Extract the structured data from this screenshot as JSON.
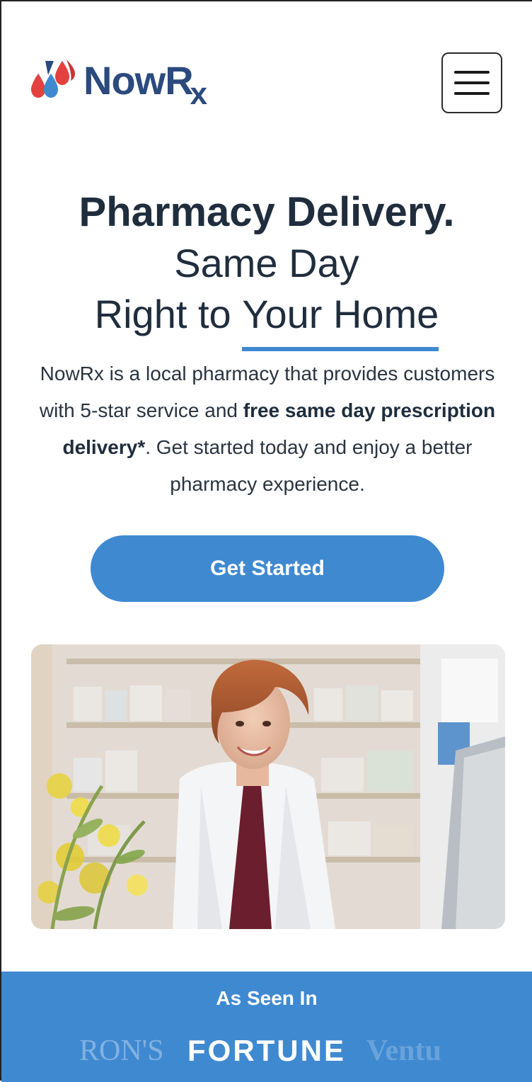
{
  "header": {
    "brand": "NowR",
    "brand_sub": "x",
    "menu_icon": "hamburger-icon"
  },
  "hero": {
    "line1": "Pharmacy Delivery.",
    "line2": "Same Day",
    "line3_prefix": "Right to ",
    "line3_underlined": "Your Home",
    "desc_pre": "NowRx is a local pharmacy that provides customers with 5-star service and ",
    "desc_bold": "free same day prescription delivery*",
    "desc_post": ". Get started today and enjoy a better pharmacy experience.",
    "cta_label": "Get Started"
  },
  "colors": {
    "brand_blue": "#3f89d1",
    "navy": "#2b4a7d",
    "drop_red": "#e2413f"
  },
  "as_seen_in": {
    "title": "As Seen In",
    "publications": [
      "RON'S",
      "FORTUNE",
      "Ventu"
    ]
  }
}
